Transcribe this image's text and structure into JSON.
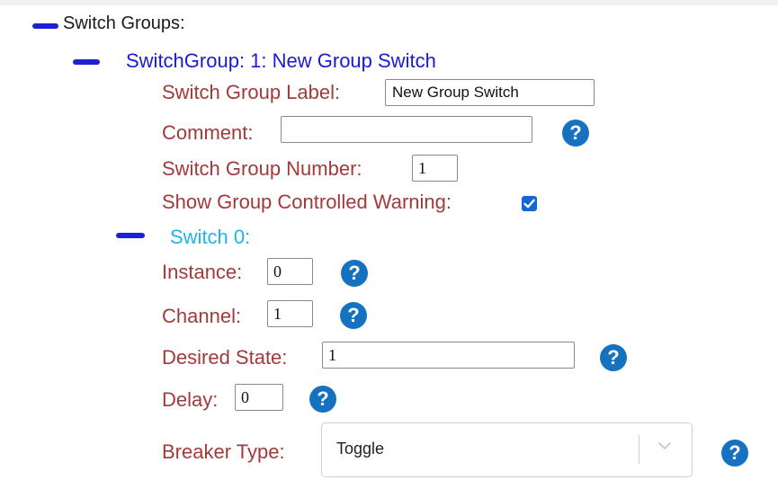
{
  "switch_groups": {
    "header_label": "Switch Groups:",
    "group": {
      "title": "SwitchGroup: 1: New Group Switch",
      "label_field": {
        "label": "Switch Group Label:",
        "value": "New Group Switch"
      },
      "comment_field": {
        "label": "Comment:",
        "value": ""
      },
      "number_field": {
        "label": "Switch Group Number:",
        "value": "1"
      },
      "warning_field": {
        "label": "Show Group Controlled Warning:",
        "checked": true
      },
      "switch": {
        "title": "Switch 0:",
        "instance": {
          "label": "Instance:",
          "value": "0"
        },
        "channel": {
          "label": "Channel:",
          "value": "1"
        },
        "desired_state": {
          "label": "Desired State:",
          "value": "1"
        },
        "delay": {
          "label": "Delay:",
          "value": "0"
        },
        "breaker_type": {
          "label": "Breaker Type:",
          "value": "Toggle"
        }
      }
    }
  },
  "help_glyph": "?",
  "colors": {
    "collapse_bar": "#1f1fd6",
    "field_label": "#a23a3a",
    "group_title": "#1a1ad6",
    "switch_title": "#22b2e6",
    "help_icon": "#1572c1",
    "checkbox": "#1366d6"
  },
  "icons": [
    "collapse-icon",
    "help-icon",
    "checkbox-checked-icon",
    "chevron-down-icon"
  ]
}
